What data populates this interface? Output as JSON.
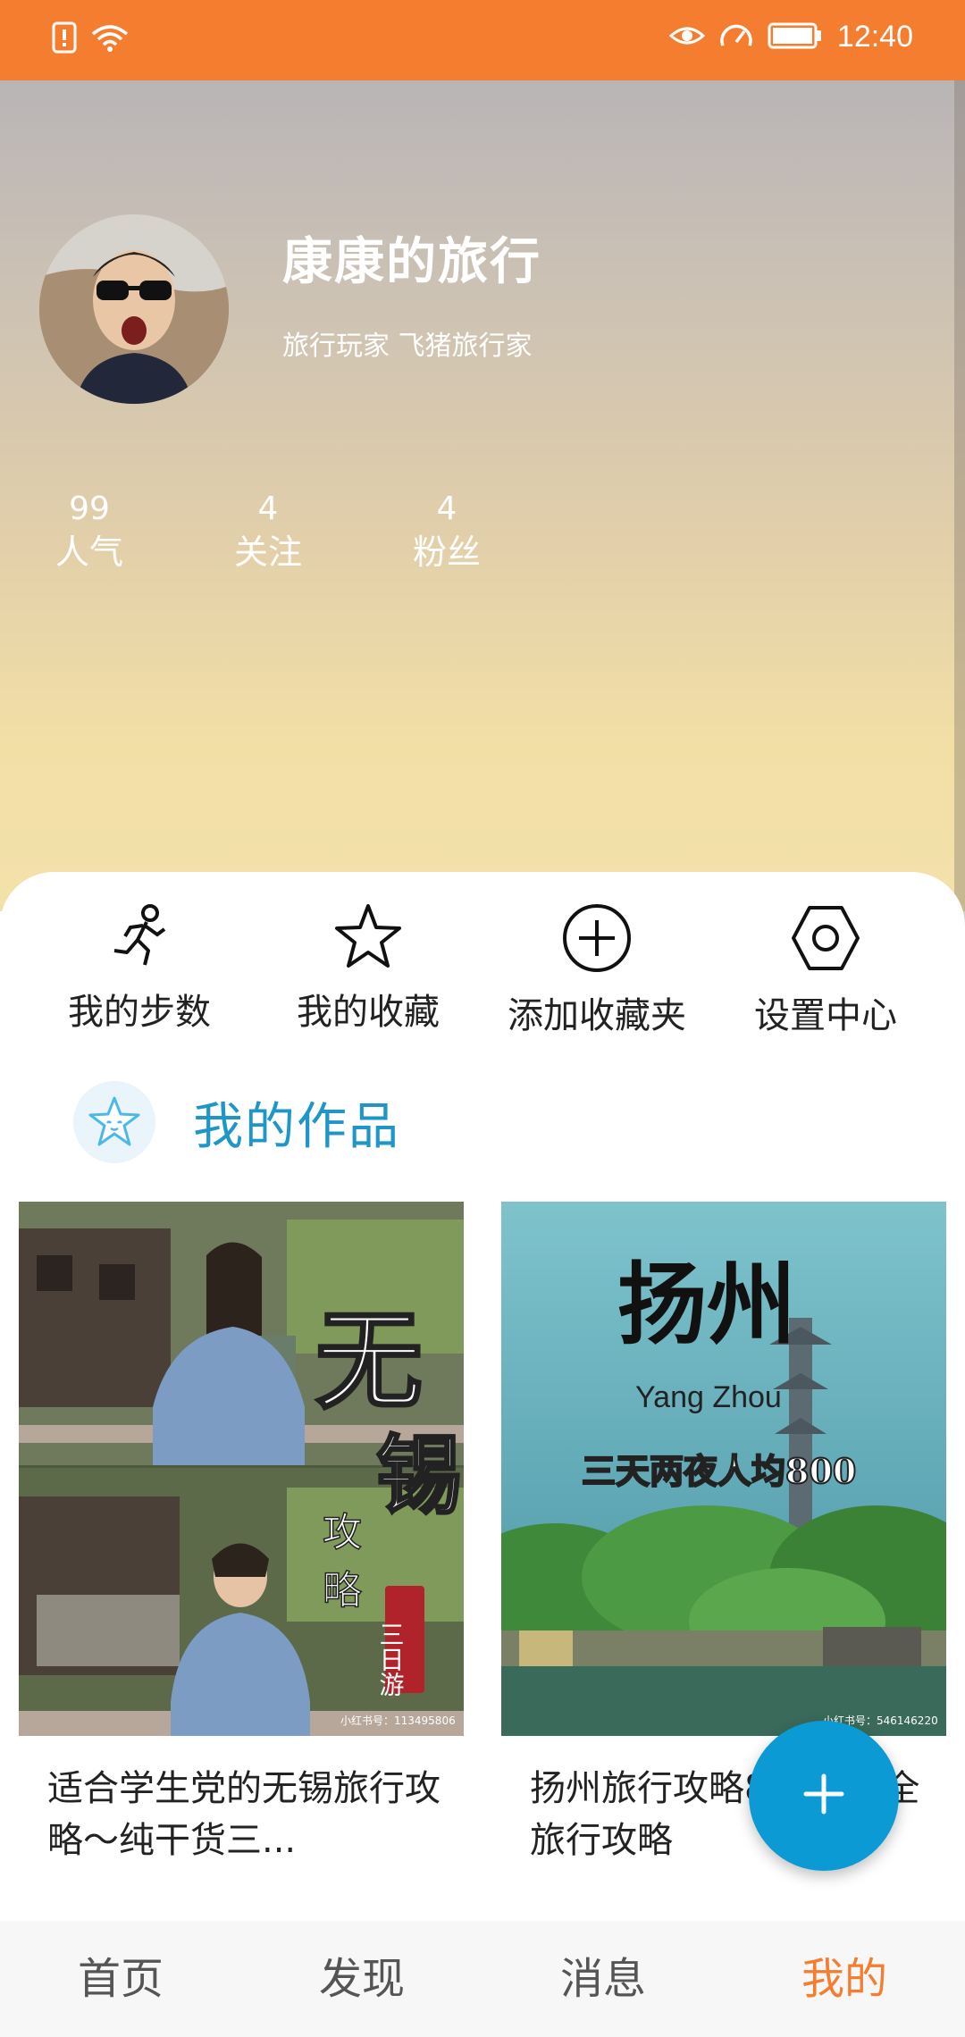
{
  "status_bar": {
    "time": "12:40",
    "left_icons": [
      "sim-alert-icon",
      "wifi-icon"
    ],
    "right_icons": [
      "eye-icon",
      "speed-icon",
      "battery-icon"
    ],
    "bg_color": "#f47d30"
  },
  "profile": {
    "name": "康康的旅行",
    "tags": "旅行玩家 飞猪旅行家",
    "stats": [
      {
        "value": "99",
        "label": "人气"
      },
      {
        "value": "4",
        "label": "关注"
      },
      {
        "value": "4",
        "label": "粉丝"
      }
    ]
  },
  "actions": [
    {
      "label": "我的步数",
      "icon": "running-icon"
    },
    {
      "label": "我的收藏",
      "icon": "star-icon"
    },
    {
      "label": "添加收藏夹",
      "icon": "add-circle-icon"
    },
    {
      "label": "设置中心",
      "icon": "settings-hexagon-icon"
    }
  ],
  "works": {
    "title": "我的作品",
    "icon": "star-face-icon",
    "title_color": "#1e96c8",
    "items": [
      {
        "title": "适合学生党的无锡旅行攻略～纯干货三...",
        "image": {
          "big_text_1": "无",
          "big_text_2": "锡",
          "sub_1": "攻",
          "sub_2": "略",
          "tag": "三日游",
          "watermark": "小红书号：113495806"
        }
      },
      {
        "title": "扬州旅行攻略800！最全旅行攻略",
        "image": {
          "big_text": "扬州",
          "pinyin": "Yang  Zhou",
          "subtitle": "三天两夜人均800",
          "watermark": "小红书号：546146220"
        }
      }
    ]
  },
  "fab": {
    "icon": "plus-icon"
  },
  "bottom_nav": {
    "items": [
      "首页",
      "发现",
      "消息",
      "我的"
    ],
    "active_index": 3,
    "active_color": "#f47d30"
  }
}
